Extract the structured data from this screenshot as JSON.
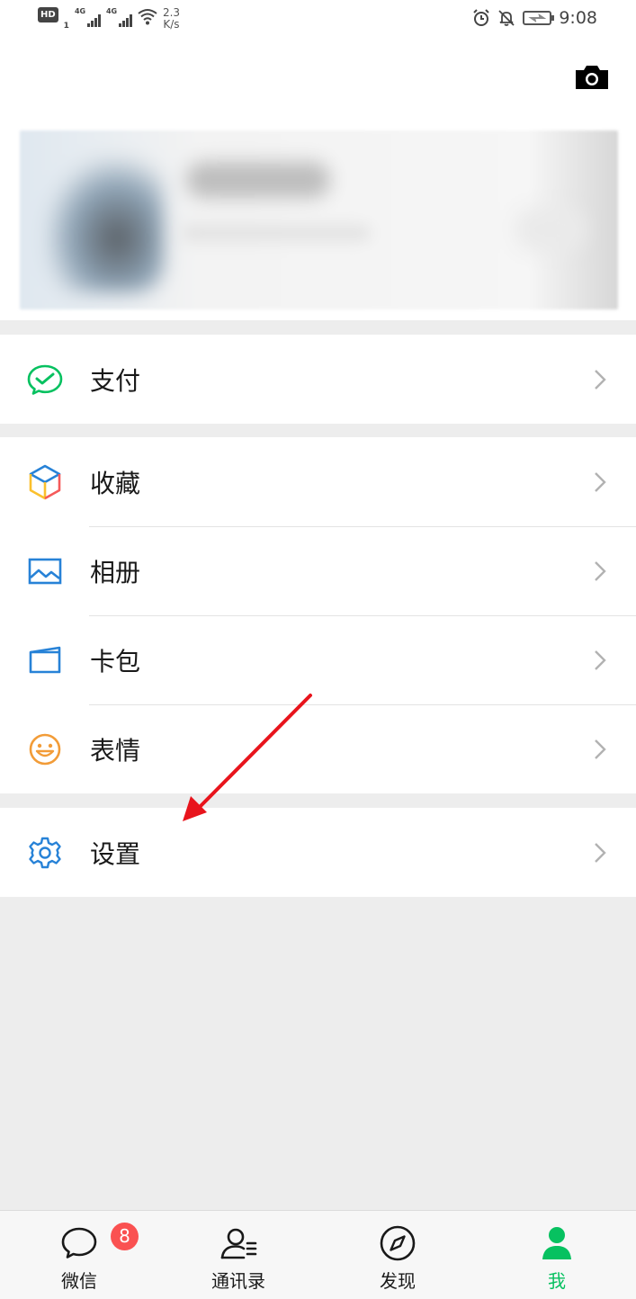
{
  "status_bar": {
    "hd_label": "HD",
    "hd_sub": "1",
    "network_1": "4G",
    "network_2": "4G",
    "speed_value": "2.3",
    "speed_unit": "K/s",
    "time": "9:08"
  },
  "menu": {
    "pay": {
      "label": "支付",
      "icon": "wechat-pay-icon",
      "color": "#07c160"
    },
    "favorites": {
      "label": "收藏",
      "icon": "favorites-cube-icon"
    },
    "album": {
      "label": "相册",
      "icon": "album-icon",
      "color": "#2782d7"
    },
    "cards": {
      "label": "卡包",
      "icon": "card-wallet-icon",
      "color": "#2782d7"
    },
    "stickers": {
      "label": "表情",
      "icon": "sticker-smile-icon",
      "color": "#f29c38"
    },
    "settings": {
      "label": "设置",
      "icon": "settings-gear-icon",
      "color": "#2782d7"
    }
  },
  "tabbar": {
    "chats": {
      "label": "微信",
      "badge": "8"
    },
    "contacts": {
      "label": "通讯录"
    },
    "discover": {
      "label": "发现"
    },
    "me": {
      "label": "我",
      "active": true
    }
  },
  "colors": {
    "accent_green": "#07c160",
    "badge_red": "#fa5151",
    "annotation_arrow": "#e8141c",
    "background": "#ededed"
  }
}
